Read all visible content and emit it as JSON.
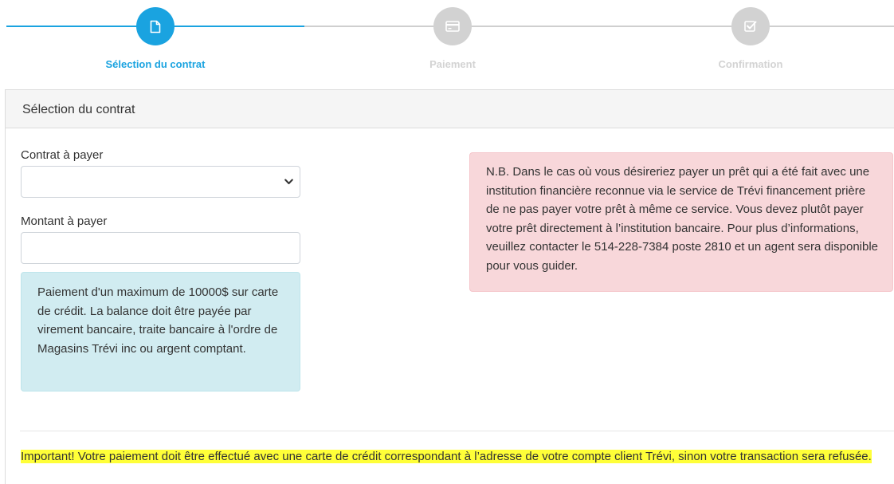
{
  "stepper": {
    "steps": [
      {
        "label": "Sélection du contrat",
        "icon": "document-icon",
        "state": "active"
      },
      {
        "label": "Paiement",
        "icon": "credit-card-icon",
        "state": "inactive"
      },
      {
        "label": "Confirmation",
        "icon": "checkbox-icon",
        "state": "inactive"
      }
    ],
    "colors": {
      "active": "#1aa3e0",
      "inactive": "#d2d2d2"
    }
  },
  "panel": {
    "heading": "Sélection du contrat",
    "contract_label": "Contrat à payer",
    "contract_selected": "",
    "amount_label": "Montant à payer",
    "amount_value": "",
    "info_alert": "Paiement d'un maximum de 10000$ sur carte de crédit. La balance doit être payée par virement bancaire, traite bancaire à l'ordre de Magasins Trévi inc ou argent comptant.",
    "warning_alert": "N.B. Dans le cas où vous désireriez payer un prêt qui a été fait avec une institution financière reconnue via le service de Trévi financement prière de ne pas payer votre prêt à même ce service. Vous devez plutôt payer votre prêt directement à l’institution bancaire. Pour plus d’informations, veuillez contacter le 514-228-7384 poste 2810 et un agent sera disponible pour vous guider.",
    "important_notice": "Important! Votre paiement doit être effectué avec une carte de crédit correspondant à l’adresse de votre compte client Trévi, sinon votre transaction sera refusée.",
    "highlight_color": "#ffff38"
  }
}
